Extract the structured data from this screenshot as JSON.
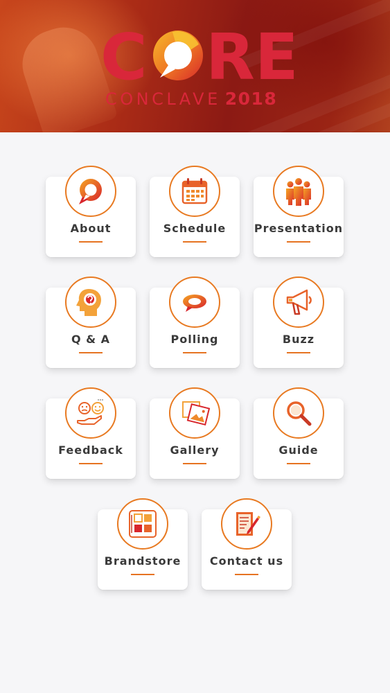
{
  "header": {
    "logo_text": "CORE",
    "subtitle_word": "CONCLAVE",
    "subtitle_year": "2018"
  },
  "colors": {
    "accent_orange": "#e87a22",
    "brand_red": "#d9273a",
    "tile_label": "#3a3a3a"
  },
  "menu": [
    {
      "label": "About",
      "icon": "chat-bubble-icon"
    },
    {
      "label": "Schedule",
      "icon": "calendar-icon"
    },
    {
      "label": "Presentation",
      "icon": "audience-icon"
    },
    {
      "label": "Q & A",
      "icon": "head-question-icon"
    },
    {
      "label": "Polling",
      "icon": "poll-bubble-icon"
    },
    {
      "label": "Buzz",
      "icon": "megaphone-icon"
    },
    {
      "label": "Feedback",
      "icon": "smiley-faces-icon"
    },
    {
      "label": "Gallery",
      "icon": "photo-frames-icon"
    },
    {
      "label": "Guide",
      "icon": "magnifier-icon"
    },
    {
      "label": "Brandstore",
      "icon": "grid-blocks-icon"
    },
    {
      "label": "Contact us",
      "icon": "notepad-pen-icon"
    }
  ]
}
